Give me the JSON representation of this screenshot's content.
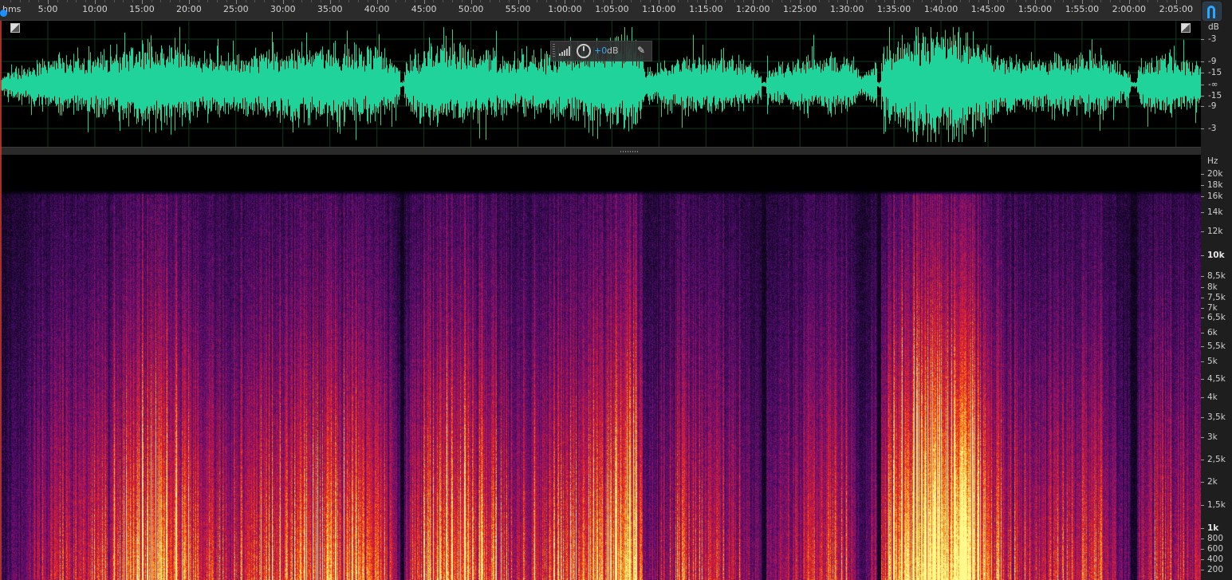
{
  "ruler": {
    "unit_label": "hms",
    "ticks": [
      "5:00",
      "10:00",
      "15:00",
      "20:00",
      "25:00",
      "30:00",
      "35:00",
      "40:00",
      "45:00",
      "50:00",
      "55:00",
      "1:00:00",
      "1:05:00",
      "1:10:00",
      "1:15:00",
      "1:20:00",
      "1:25:00",
      "1:30:00",
      "1:35:00",
      "1:40:00",
      "1:45:00",
      "1:50:00",
      "1:55:00",
      "2:00:00",
      "2:05:00"
    ]
  },
  "corner_button": {
    "icon": "magnet-icon",
    "color": "#2ea8ff"
  },
  "toolbar": {
    "gain_value": "+0",
    "gain_unit": "dB"
  },
  "db_scale": {
    "labels": [
      "dB",
      "-3",
      "-9",
      "-15",
      "-∞",
      "-15",
      "-9",
      "-3"
    ]
  },
  "hz_scale": {
    "labels": [
      "Hz",
      "20k",
      "18k",
      "16k",
      "14k",
      "12k",
      "10k",
      "8,5k",
      "8k",
      "7,5k",
      "7k",
      "6,5k",
      "6k",
      "5,5k",
      "5k",
      "4,5k",
      "4k",
      "3,5k",
      "3k",
      "2,5k",
      "2k",
      "1,5k",
      "1k",
      "800",
      "600",
      "400",
      "200"
    ]
  },
  "colors": {
    "waveform": "#1fd39a",
    "playhead": "#1e90ff",
    "accent": "#2ea8ff"
  }
}
